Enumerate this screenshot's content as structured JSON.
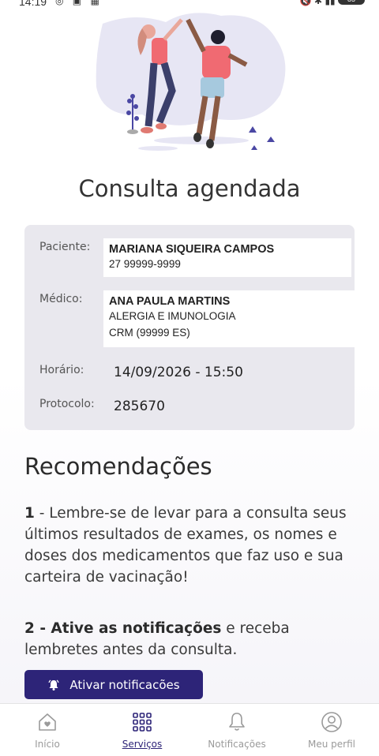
{
  "status_bar": {
    "time": "14:19",
    "battery": "85"
  },
  "page_title": "Consulta agendada",
  "appointment": {
    "patient_label": "Paciente:",
    "patient_name": "MARIANA SIQUEIRA CAMPOS",
    "patient_phone": "27 99999-9999",
    "doctor_label": "Médico:",
    "doctor_name": "ANA PAULA MARTINS",
    "doctor_specialty": "ALERGIA E IMUNOLOGIA",
    "doctor_crm": "CRM (99999 ES)",
    "time_label": "Horário:",
    "time_value": "14/09/2026 - 15:50",
    "protocol_label": "Protocolo:",
    "protocol_value": "285670"
  },
  "recommendations": {
    "title": "Recomendações",
    "item1_number": "1",
    "item1_text": " - Lembre-se de levar para a consulta seus últimos resultados de exames, os nomes e doses dos medicamentos que faz uso e sua carteira de vacinação!",
    "item2_bold": "2 - Ative as notificações",
    "item2_text": " e receba lembretes antes da consulta.",
    "notif_button_label": "Ativar notificacões"
  },
  "bottom_nav": {
    "items": [
      {
        "label": "Início",
        "icon": "home-heart-icon"
      },
      {
        "label": "Serviços",
        "icon": "grid-icon"
      },
      {
        "label": "Notificações",
        "icon": "bell-icon"
      },
      {
        "label": "Meu perfil",
        "icon": "user-icon"
      }
    ],
    "active": "Serviços",
    "active_color": "#2d2478"
  },
  "colors": {
    "accent": "#2d2478",
    "card_bg": "#e9e8ee"
  }
}
